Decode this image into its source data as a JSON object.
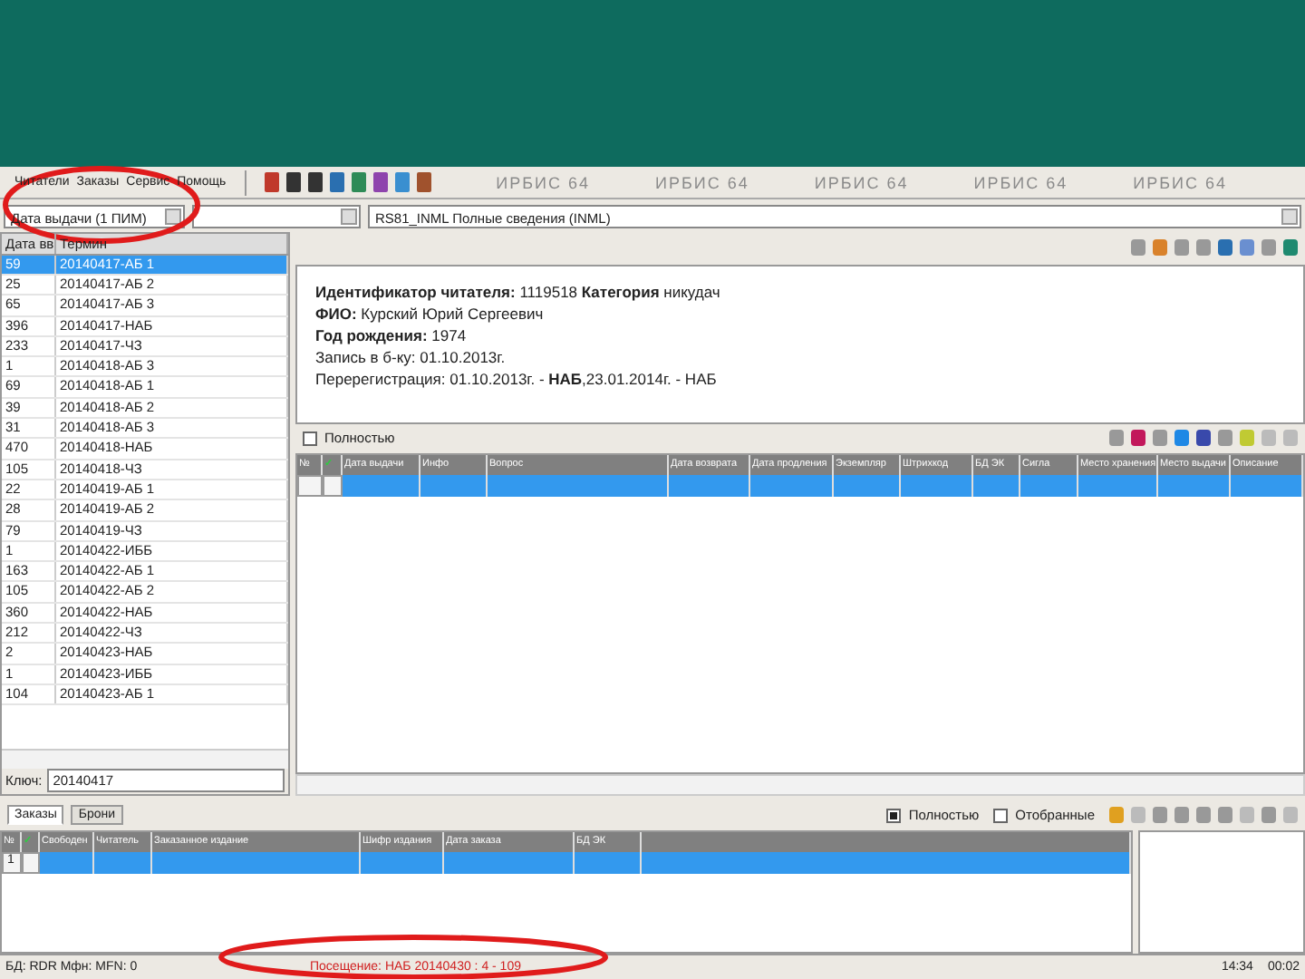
{
  "menu": [
    "Читатели",
    "Заказы",
    "Сервис",
    "Помощь"
  ],
  "watermarks": [
    "ИРБИС 64",
    "ИРБИС 64",
    "ИРБИС 64",
    "ИРБИС 64",
    "ИРБИС 64"
  ],
  "filters": {
    "mode": "Дата выдачи (1 ПИМ)",
    "format": "RS81_INML Полные сведения (INML)"
  },
  "terms": {
    "columns": [
      "Дата вв",
      "Термин"
    ],
    "rows": [
      {
        "count": "59",
        "term": "20140417-АБ 1",
        "selected": true
      },
      {
        "count": "25",
        "term": "20140417-АБ 2",
        "selected": false
      },
      {
        "count": "65",
        "term": "20140417-АБ 3",
        "selected": false
      },
      {
        "count": "396",
        "term": "20140417-НАБ",
        "selected": false
      },
      {
        "count": "233",
        "term": "20140417-ЧЗ",
        "selected": false
      },
      {
        "count": "1",
        "term": "20140418-АБ 3",
        "selected": false
      },
      {
        "count": "69",
        "term": "20140418-АБ 1",
        "selected": false
      },
      {
        "count": "39",
        "term": "20140418-АБ 2",
        "selected": false
      },
      {
        "count": "31",
        "term": "20140418-АБ 3",
        "selected": false
      },
      {
        "count": "470",
        "term": "20140418-НАБ",
        "selected": false
      },
      {
        "count": "105",
        "term": "20140418-ЧЗ",
        "selected": false
      },
      {
        "count": "22",
        "term": "20140419-АБ 1",
        "selected": false
      },
      {
        "count": "28",
        "term": "20140419-АБ 2",
        "selected": false
      },
      {
        "count": "79",
        "term": "20140419-ЧЗ",
        "selected": false
      },
      {
        "count": "1",
        "term": "20140422-ИББ",
        "selected": false
      },
      {
        "count": "163",
        "term": "20140422-АБ 1",
        "selected": false
      },
      {
        "count": "105",
        "term": "20140422-АБ 2",
        "selected": false
      },
      {
        "count": "360",
        "term": "20140422-НАБ",
        "selected": false
      },
      {
        "count": "212",
        "term": "20140422-ЧЗ",
        "selected": false
      },
      {
        "count": "2",
        "term": "20140423-НАБ",
        "selected": false
      },
      {
        "count": "1",
        "term": "20140423-ИББ",
        "selected": false
      },
      {
        "count": "104",
        "term": "20140423-АБ 1",
        "selected": false
      }
    ],
    "key_label": "Ключ:",
    "key_value": "20140417"
  },
  "record": [
    "**Идентификатор читателя:** 1119518 **Категория** никудач",
    "**ФИО:** Курский Юрий Сергеевич",
    "**Год рождения:** 1974",
    "Запись в б-ку: 01.10.2013г.",
    "Перерегистрация: 01.10.2013г. - **НАБ**,23.01.2014г. - НАБ"
  ],
  "loans": {
    "full": {
      "label": "Полностью",
      "checked": false
    },
    "columns": [
      "№",
      "✓",
      "Дата выдачи",
      "Инфо",
      "Вопрос",
      "Дата возврата",
      "Дата продления",
      "Экземпляр",
      "Штрихкод",
      "БД ЭК",
      "Сигла",
      "Место хранения",
      "Место выдачи",
      "Описание"
    ]
  },
  "tabs": [
    {
      "label": "Заказы",
      "selected": true
    },
    {
      "label": "Брони",
      "selected": false
    }
  ],
  "orders": {
    "options": [
      {
        "label": "Полностью",
        "checked": true
      },
      {
        "label": "Отобранные",
        "checked": false
      }
    ],
    "columns": [
      "№",
      "✓",
      "Свободен",
      "Читатель",
      "Заказанное издание",
      "Шифр издания",
      "Дата заказа",
      "БД ЭК"
    ],
    "row_number": "1"
  },
  "status_bar": {
    "database": "БД: RDR Мфн: MFN: 0",
    "visit": "Посещение: НАБ 20140430 : 4 - 109",
    "time": "14:34",
    "elapsed": "00:02"
  }
}
